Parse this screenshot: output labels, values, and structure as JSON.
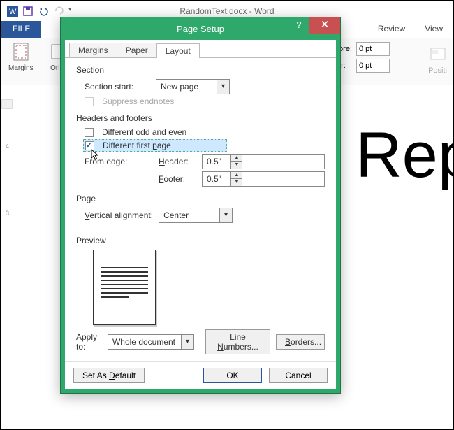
{
  "window": {
    "title": "RandomText.docx - Word"
  },
  "ribbon": {
    "file": "FILE",
    "tabs_visible": [
      "Review",
      "View"
    ],
    "margins": "Margins",
    "orient": "Orie",
    "before": "efore:",
    "after": "fter:",
    "before_val": "0 pt",
    "after_val": "0 pt",
    "posit": "Positi"
  },
  "document": {
    "fragment": "f Rep"
  },
  "dialog": {
    "title": "Page Setup",
    "tabs": {
      "margins": "Margins",
      "paper": "Paper",
      "layout": "Layout"
    },
    "section": {
      "heading": "Section",
      "start_label": "Section start:",
      "start_value": "New page",
      "suppress": "Suppress endnotes"
    },
    "hf": {
      "heading": "Headers and footers",
      "odd_even": "Different odd and even",
      "first_page": "Different first page",
      "from_edge": "From edge:",
      "header_label": "Header:",
      "footer_label": "Footer:",
      "header_val": "0.5\"",
      "footer_val": "0.5\""
    },
    "page": {
      "heading": "Page",
      "valign_label": "Vertical alignment:",
      "valign_value": "Center"
    },
    "preview": {
      "heading": "Preview"
    },
    "apply": {
      "label": "Apply to:",
      "value": "Whole document",
      "line_numbers": "Line Numbers...",
      "borders": "Borders..."
    },
    "buttons": {
      "default": "Set As Default",
      "ok": "OK",
      "cancel": "Cancel"
    }
  }
}
